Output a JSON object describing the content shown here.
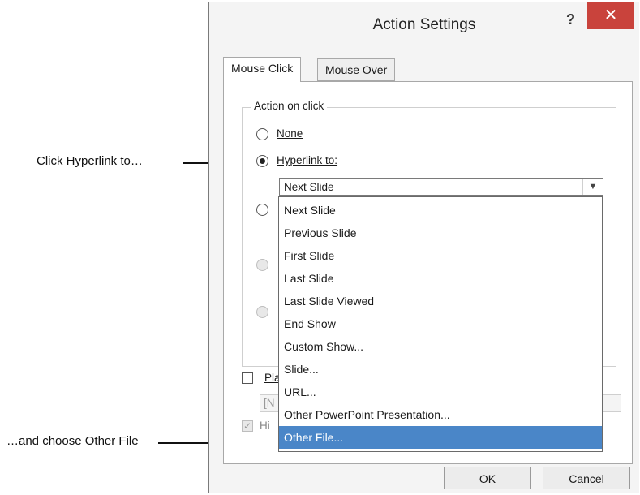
{
  "dialog": {
    "title": "Action Settings",
    "help_label": "?",
    "close_label": "✕"
  },
  "tabs": [
    {
      "label": "Mouse Click",
      "active": true
    },
    {
      "label": "Mouse Over",
      "active": false
    }
  ],
  "action_group": {
    "label": "Action on click",
    "none_label": "None",
    "hyperlink_label": "Hyperlink to:",
    "hyperlink_value": "Next Slide",
    "selected_option": "Hyperlink to:"
  },
  "play_sound": {
    "label_partial": "Pla",
    "value_partial": "[N"
  },
  "highlight": {
    "label_partial": "Hi"
  },
  "dropdown": {
    "options": [
      "Next Slide",
      "Previous Slide",
      "First Slide",
      "Last Slide",
      "Last Slide Viewed",
      "End Show",
      "Custom Show...",
      "Slide...",
      "URL...",
      "Other PowerPoint Presentation...",
      "Other File..."
    ],
    "highlighted": "Other File..."
  },
  "buttons": {
    "ok": "OK",
    "cancel": "Cancel"
  },
  "callouts": {
    "top": "Click Hyperlink to…",
    "bottom": "…and choose Other File"
  },
  "colors": {
    "close_red": "#c9433c",
    "selection_blue": "#4a86c8"
  }
}
